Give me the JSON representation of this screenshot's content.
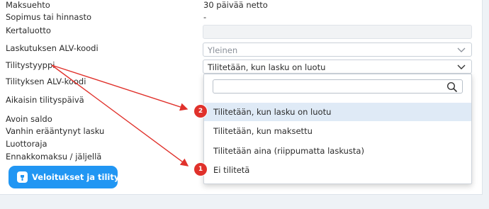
{
  "form": {
    "rows": [
      {
        "label": "Maksuehto",
        "value": "30 päivää netto"
      },
      {
        "label": "Sopimus tai hinnasto",
        "value": "-"
      },
      {
        "label": "Kertaluotto",
        "value": ""
      },
      {
        "label": "Laskutuksen ALV-koodi",
        "value": "Yleinen"
      },
      {
        "label": "Tilitystyyppi",
        "value": "Tilitetään, kun lasku on luotu"
      },
      {
        "label": "Tilityksen ALV-koodi",
        "value": ""
      },
      {
        "label": "Aikaisin tilityspäivä",
        "value": ""
      },
      {
        "label": "Avoin saldo",
        "value": ""
      },
      {
        "label": "Vanhin erääntynyt lasku",
        "value": ""
      },
      {
        "label": "Luottoraja",
        "value": ""
      },
      {
        "label": "Ennakkomaksu / jäljellä",
        "value": ""
      }
    ]
  },
  "dropdown": {
    "search_placeholder": "",
    "search_icon": "search-icon",
    "options": [
      {
        "label": "Tilitetään, kun lasku on luotu",
        "highlighted": true,
        "badge": "2"
      },
      {
        "label": "Tilitetään, kun maksettu",
        "highlighted": false,
        "badge": ""
      },
      {
        "label": "Tilitetään aina (riippumatta laskusta)",
        "highlighted": false,
        "badge": ""
      },
      {
        "label": "Ei tilitetä",
        "highlighted": false,
        "badge": "1"
      }
    ]
  },
  "action_button": {
    "label": "Veloitukset ja tilitykset",
    "icon": "wallet-icon"
  },
  "colors": {
    "accent_blue": "#2196f3",
    "annotation_red": "#e0312b",
    "highlight": "#dfeaf6"
  }
}
